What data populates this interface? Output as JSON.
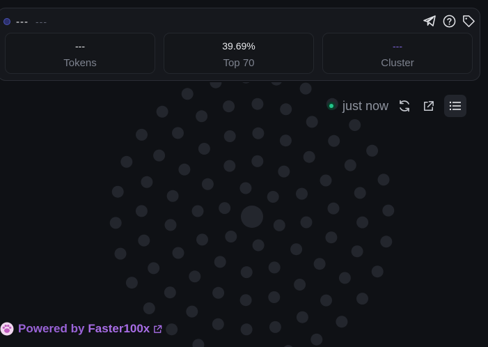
{
  "header": {
    "title": "---",
    "subtitle": "---"
  },
  "stats": [
    {
      "value": "---",
      "label": "Tokens"
    },
    {
      "value": "39.69%",
      "label": "Top 70"
    },
    {
      "value": "---",
      "label": "Cluster"
    }
  ],
  "status": {
    "updated": "just now"
  },
  "footer": {
    "powered_by": "Powered by",
    "brand": "Faster100x"
  },
  "colors": {
    "accent": "#9a63d8",
    "live": "#22c58b",
    "bubble": "#23262d"
  },
  "icons": [
    "telegram-icon",
    "help-icon",
    "tag-icon",
    "refresh-icon",
    "external-link-icon",
    "list-icon",
    "paw-icon"
  ]
}
